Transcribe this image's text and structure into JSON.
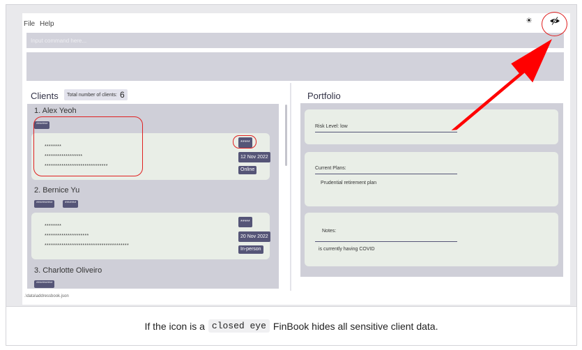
{
  "menu": {
    "file": "File",
    "help": "Help"
  },
  "toolbar": {
    "theme_icon": "sun-icon",
    "privacy_icon": "eye-closed-icon"
  },
  "command": {
    "placeholder": "Input command here..."
  },
  "clients": {
    "title": "Clients",
    "count_label": "Total number of clients:",
    "count": "6",
    "items": [
      {
        "name": "1.  Alex Yeoh",
        "tags": [
          "*******"
        ],
        "lines": [
          "********",
          "******************",
          "******************************"
        ],
        "badges": [
          "*****",
          "12 Nov 2022",
          "Online"
        ]
      },
      {
        "name": "2.  Bernice Yu",
        "tags": [
          "**********",
          "*******"
        ],
        "lines": [
          "********",
          "*********************",
          "****************************************"
        ],
        "badges": [
          "*****",
          "20 Nov 2022",
          "In-person"
        ]
      },
      {
        "name": "3.  Charlotte Oliveiro",
        "tags": [
          "**********"
        ]
      }
    ]
  },
  "portfolio": {
    "title": "Portfolio",
    "risk_label": "Risk Level: low",
    "plans_label": "Current Plans:",
    "plans_value": "Prudential retirement plan",
    "notes_label": "Notes:",
    "notes_value": "is currently having COVID"
  },
  "status": {
    "file_path": ".\\data\\addressbook.json"
  },
  "caption": {
    "before": "If the icon is a",
    "code": "closed eye",
    "after": "FinBook hides all sensitive client data."
  },
  "colors": {
    "tag_bg": "#555577",
    "panel_bg": "#cfcfd8",
    "card_bg": "#e9eee7",
    "annotation": "#e02020"
  }
}
